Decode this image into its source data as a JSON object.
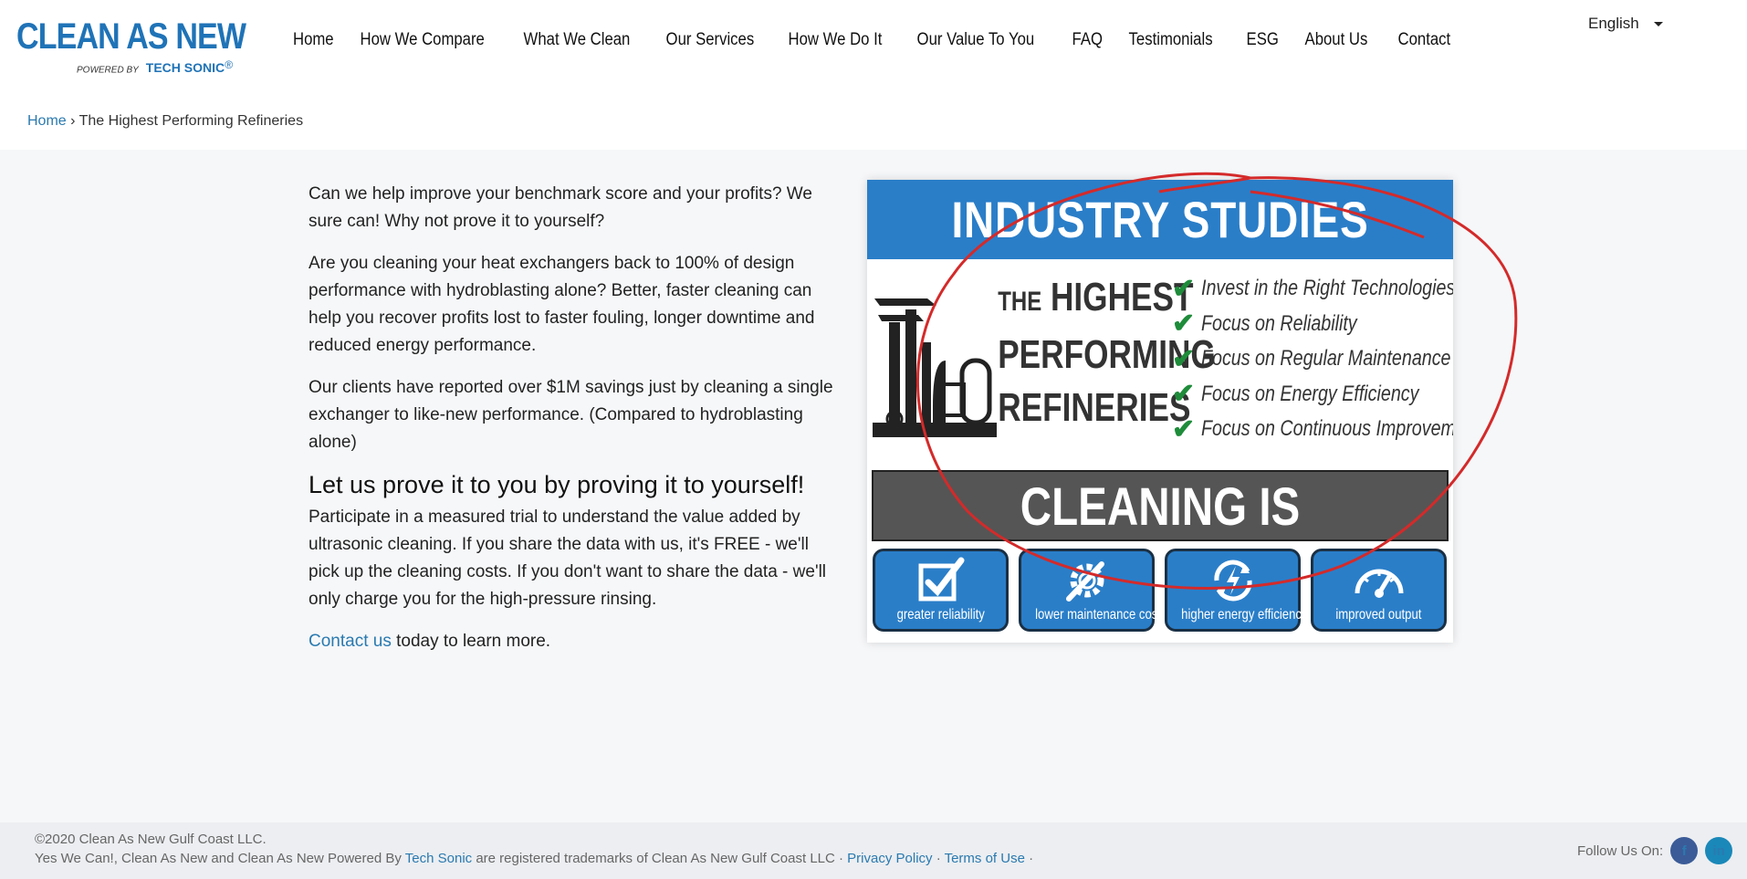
{
  "brand": {
    "name": "Clean As New",
    "powered_by": "POWERED BY",
    "partner": "Tech Sonic",
    "registered": "®",
    "color": "#1f73b7"
  },
  "nav": {
    "items": [
      {
        "label": "Home"
      },
      {
        "label": "How We Compare"
      },
      {
        "label": "What We Clean"
      },
      {
        "label": "Our Services"
      },
      {
        "label": "How We Do It"
      },
      {
        "label": "Our Value To You"
      },
      {
        "label": "FAQ"
      },
      {
        "label": "Testimonials"
      },
      {
        "label": "ESG"
      },
      {
        "label": "About Us"
      },
      {
        "label": "Contact"
      }
    ]
  },
  "language": {
    "selected": "English"
  },
  "breadcrumb": {
    "home": "Home",
    "separator": "›",
    "current": "The Highest Performing Refineries"
  },
  "content": {
    "p1": "Can we help improve your benchmark score and your profits? We sure can! Why not prove it to yourself?",
    "p2": "Are you cleaning your heat exchangers back to 100% of design performance with hydroblasting alone? Better, faster cleaning can help you recover profits lost to faster fouling, longer downtime and reduced energy performance.",
    "p3": "Our clients have reported over $1M savings just by cleaning a single exchanger to like-new performance. (Compared to hydroblasting alone)",
    "heading": "Let us prove it to you by proving it to yourself!",
    "p4": "Participate in a measured trial to understand the value added by ultrasonic cleaning. If you share the data with us, it's FREE - we'll pick up the cleaning costs. If you don't want to share the data - we'll only charge you for the high-pressure rinsing.",
    "contact_link": "Contact us",
    "contact_suffix": " today to learn more."
  },
  "infographic": {
    "banner": "INDUSTRY STUDIES SHOW",
    "highest_the": "THE",
    "highest_word": "HIGHEST",
    "line2": "PERFORMING",
    "line3": "REFINERIES",
    "checks": [
      "Invest in the Right Technologies",
      "Focus on Reliability",
      "Focus on Regular Maintenance",
      "Focus on Energy Efficiency",
      "Focus on Continuous Improvement"
    ],
    "cleaning": "CLEANING IS BELIEVING",
    "benefits": [
      {
        "label": "greater reliability",
        "icon": "checkbox-icon"
      },
      {
        "label": "lower maintenance cost",
        "icon": "gear-wrench-icon"
      },
      {
        "label": "higher energy efficiency",
        "icon": "energy-cycle-icon"
      },
      {
        "label": "improved output",
        "icon": "gauge-icon"
      }
    ],
    "colors": {
      "blue": "#2a7ec8",
      "check_green": "#1e8c3a",
      "banner_gray": "#555555",
      "annotation_red": "#d42a2a"
    }
  },
  "footer": {
    "copyright": "©2020 Clean As New Gulf Coast LLC.",
    "trademark_prefix": "Yes We Can!, Clean As New and Clean As New Powered By ",
    "tech_sonic": "Tech Sonic",
    "trademark_suffix": " are registered trademarks of Clean As New Gulf Coast LLC · ",
    "privacy": "Privacy Policy",
    "dot": " · ",
    "terms": "Terms of Use",
    "end_dot": " ·",
    "follow": "Follow Us On:",
    "facebook": "f",
    "linkedin": "in"
  }
}
